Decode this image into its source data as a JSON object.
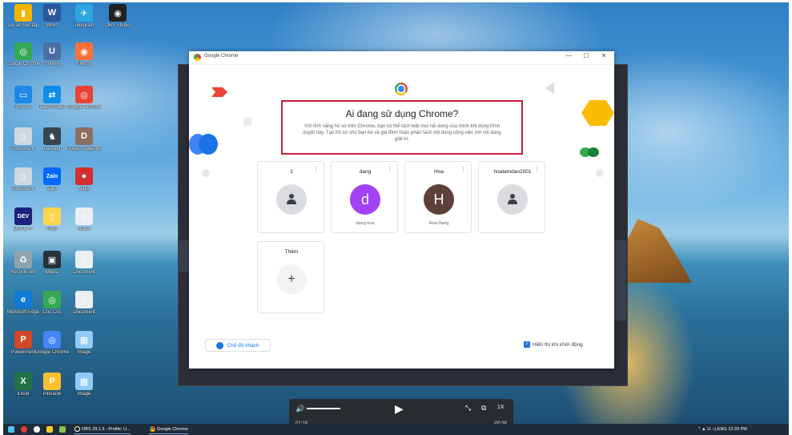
{
  "desktop_icons": [
    {
      "label": "Dự án học tập",
      "glyph": "▮",
      "color": "#f4b400"
    },
    {
      "label": "Word",
      "glyph": "W",
      "color": "#2b579a"
    },
    {
      "label": "Telegram",
      "glyph": "✈",
      "color": "#2ca5e0"
    },
    {
      "label": "OBS Studio",
      "glyph": "◉",
      "color": "#222222"
    },
    {
      "label": "Google Chrome",
      "glyph": "◎",
      "color": "#34a853"
    },
    {
      "label": "UniKey",
      "glyph": "U",
      "color": "#4a6fa5"
    },
    {
      "label": "Firefox",
      "glyph": "◉",
      "color": "#ff7139"
    },
    {
      "label": "This PC",
      "glyph": "▭",
      "color": "#1e88e5"
    },
    {
      "label": "TeamViewer",
      "glyph": "⇄",
      "color": "#0e8ee9"
    },
    {
      "label": "Google Chrome",
      "glyph": "◎",
      "color": "#ea4335"
    },
    {
      "label": "Document",
      "glyph": "▯",
      "color": "#cfd8dc"
    },
    {
      "label": "Gaming",
      "glyph": "♞",
      "color": "#37474f"
    },
    {
      "label": "Dragon Legends",
      "glyph": "D",
      "color": "#8d6e63"
    },
    {
      "label": "Document",
      "glyph": "▯",
      "color": "#cfd8dc"
    },
    {
      "label": "Zalo",
      "glyph": "Zalo",
      "color": "#0068ff"
    },
    {
      "label": "Ninja",
      "glyph": "●",
      "color": "#d32f2f"
    },
    {
      "label": "Dev-C++",
      "glyph": "DEV",
      "color": "#1a237e"
    },
    {
      "label": "Files",
      "glyph": "▯",
      "color": "#ffd54f"
    },
    {
      "label": "Notes",
      "glyph": "▯",
      "color": "#eceff1"
    },
    {
      "label": "Recycle Bin",
      "glyph": "♻",
      "color": "#90a4ae"
    },
    {
      "label": "Media",
      "glyph": "▣",
      "color": "#263238"
    },
    {
      "label": "Document",
      "glyph": "▯",
      "color": "#eceff1"
    },
    {
      "label": "Microsoft Edge",
      "glyph": "e",
      "color": "#0f7bd6"
    },
    {
      "label": "Cốc Cốc",
      "glyph": "◎",
      "color": "#34a853"
    },
    {
      "label": "Document",
      "glyph": "▯",
      "color": "#eceff1"
    },
    {
      "label": "PowerPoint",
      "glyph": "P",
      "color": "#d24726"
    },
    {
      "label": "Google Chrome",
      "glyph": "◎",
      "color": "#4285f4"
    },
    {
      "label": "Image",
      "glyph": "▦",
      "color": "#90caf9"
    },
    {
      "label": "Excel",
      "glyph": "X",
      "color": "#217346"
    },
    {
      "label": "Pinnacle",
      "glyph": "P",
      "color": "#fbc02d"
    },
    {
      "label": "Image",
      "glyph": "▦",
      "color": "#90caf9"
    }
  ],
  "chrome_window": {
    "title": "Google Chrome",
    "minimize": "—",
    "maximize": "☐",
    "close": "✕",
    "heading": "Ai đang sử dụng Chrome?",
    "description": "Với tính năng hồ sơ trên Chrome, bạn có thể tách biệt mọi nội dung của mình khi dùng trình duyệt này. Tạo hồ sơ cho bạn bè và gia đình hoặc phân tách nội dung công việc với nội dung giải trí.",
    "profiles": [
      {
        "name": "1",
        "sub": "",
        "initial": "",
        "avatar_color": "#dadce0",
        "more": "⋮"
      },
      {
        "name": "dang",
        "sub": "dang hoa",
        "initial": "d",
        "avatar_color": "#a142f4",
        "more": "⋮"
      },
      {
        "name": "Hoa",
        "sub": "Hoa Dang",
        "initial": "H",
        "avatar_color": "#5d4037",
        "more": "⋮"
      },
      {
        "name": "hoatamdao2001",
        "sub": "",
        "initial": "",
        "avatar_color": "#dadce0",
        "more": "⋮"
      }
    ],
    "add_profile": {
      "label": "Thêm",
      "plus": "+"
    },
    "guest_mode": "Chế độ khách",
    "show_on_startup": "Hiển thị khi khởi động",
    "show_on_startup_checked": true
  },
  "player": {
    "volume_icon": "🔊",
    "play_icon": "▶",
    "current_time": "01:18",
    "remaining_time": "-00:38",
    "progress": 0.7,
    "shrink_icon": "⤡",
    "pip_icon": "⧉",
    "speed_icon": "1X"
  },
  "taskbar": {
    "tasks": [
      {
        "label": "OBS 29.1.3 - Profile: U...",
        "color": "#222222"
      },
      {
        "label": "Google Chrome",
        "color": "#ea4335"
      }
    ],
    "tray": "^ ▲ ⊡ ◁ᵢ ENG  12:33 PM"
  }
}
